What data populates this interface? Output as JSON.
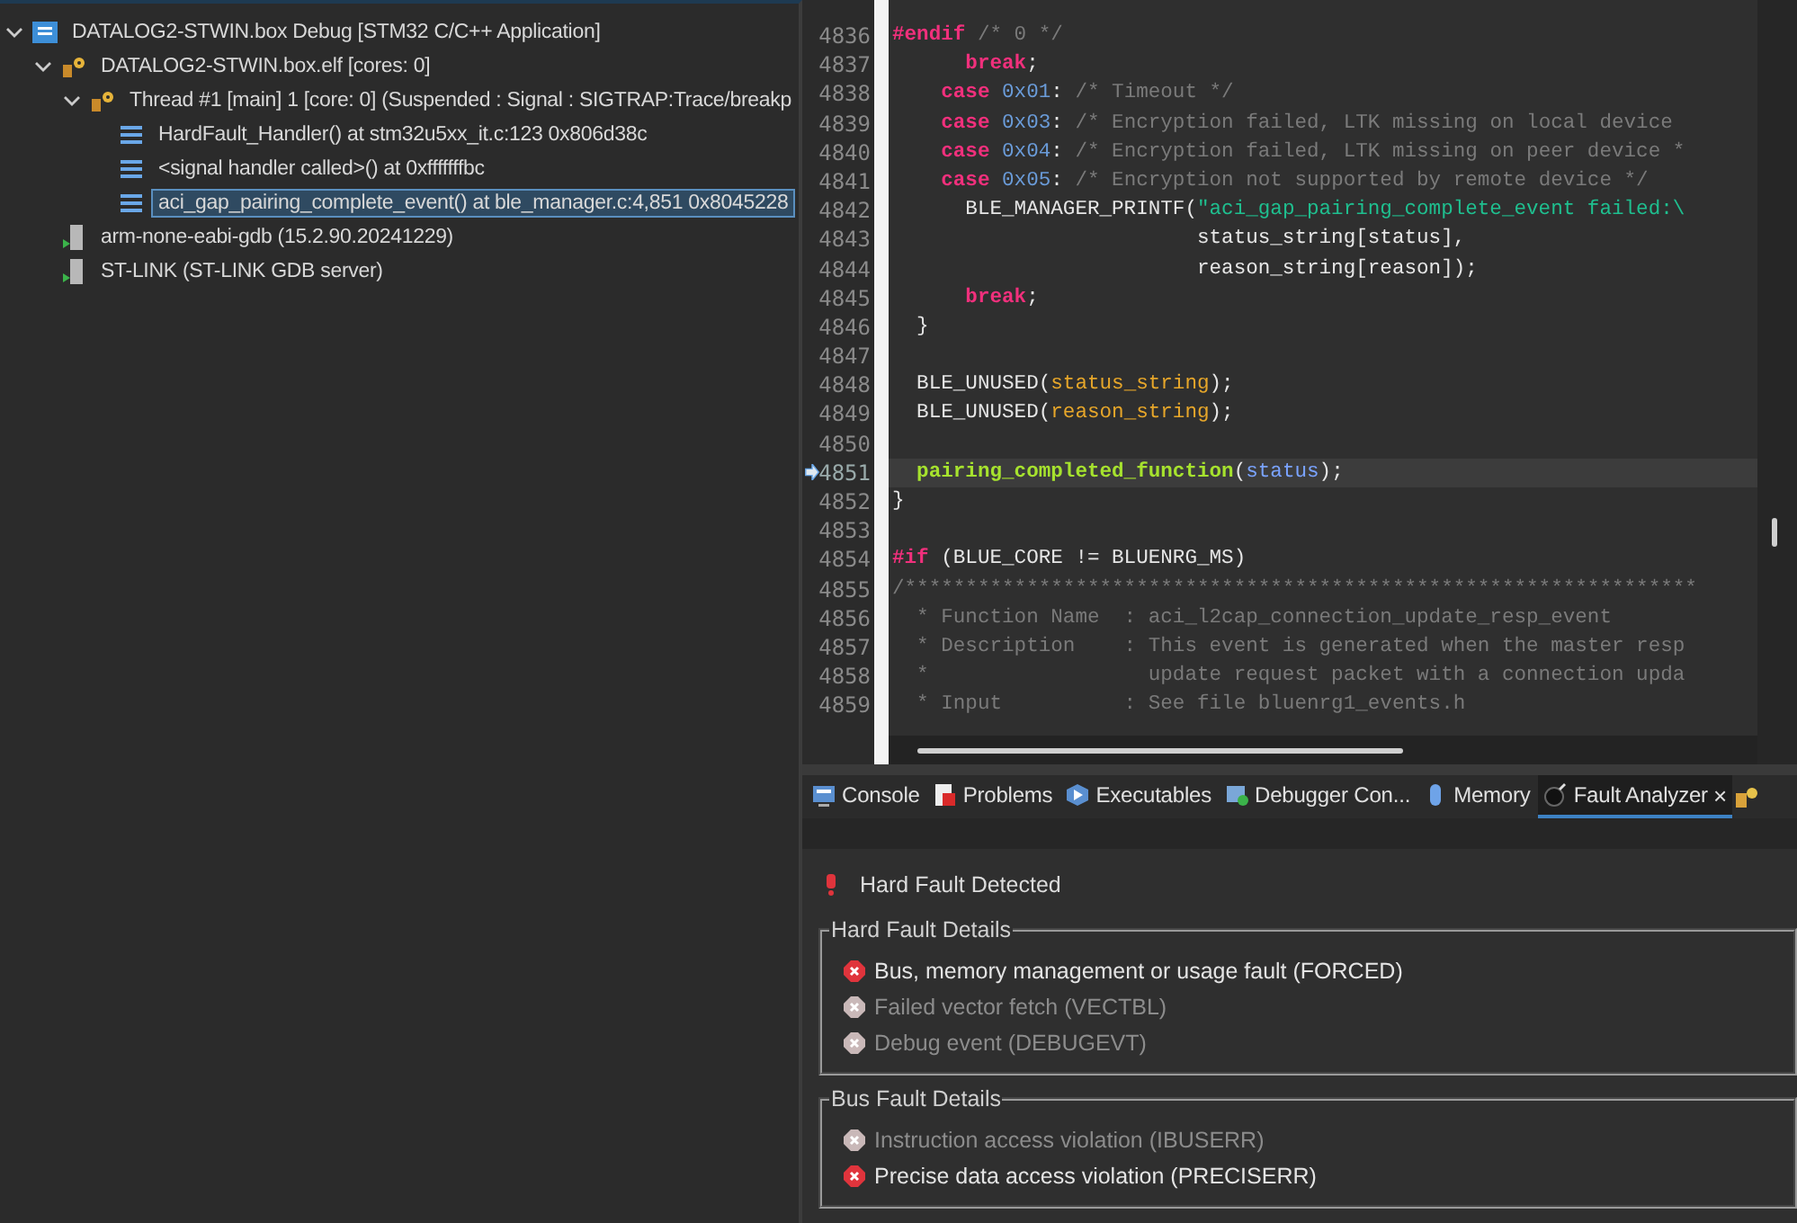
{
  "debug_tree": [
    {
      "label": "DATALOG2-STWIN.box Debug [STM32 C/C++ Application]",
      "kind": "launch",
      "expanded": true,
      "selected": false,
      "children": [
        {
          "label": "DATALOG2-STWIN.box.elf [cores: 0]",
          "kind": "process",
          "expanded": true,
          "selected": false,
          "children": [
            {
              "label": "Thread #1 [main] 1 [core: 0] (Suspended : Signal : SIGTRAP:Trace/breakp",
              "kind": "thread",
              "expanded": true,
              "selected": false,
              "children": [
                {
                  "label": "HardFault_Handler() at stm32u5xx_it.c:123 0x806d38c",
                  "kind": "frame",
                  "selected": false
                },
                {
                  "label": "<signal handler called>() at 0xfffffffbc",
                  "kind": "frame",
                  "selected": false
                },
                {
                  "label": "aci_gap_pairing_complete_event() at ble_manager.c:4,851 0x8045228",
                  "kind": "frame",
                  "selected": true
                }
              ]
            }
          ]
        },
        {
          "label": "arm-none-eabi-gdb (15.2.90.20241229)",
          "kind": "server",
          "selected": false
        },
        {
          "label": "ST-LINK (ST-LINK GDB server)",
          "kind": "server",
          "selected": false
        }
      ]
    }
  ],
  "editor": {
    "lines": [
      {
        "number": "4836",
        "current": false,
        "tokens": [
          {
            "kind": "keyword",
            "text": "#endif"
          },
          {
            "kind": "comment",
            "text": " /* 0 */"
          }
        ]
      },
      {
        "number": "4837",
        "current": false,
        "tokens": [
          {
            "kind": "keyword",
            "text": "      break"
          },
          {
            "kind": "plain",
            "text": ";"
          }
        ]
      },
      {
        "number": "4838",
        "current": false,
        "tokens": [
          {
            "kind": "keyword",
            "text": "    case"
          },
          {
            "kind": "number",
            "text": " 0x01"
          },
          {
            "kind": "plain",
            "text": ": "
          },
          {
            "kind": "comment",
            "text": "/* Timeout */"
          }
        ]
      },
      {
        "number": "4839",
        "current": false,
        "tokens": [
          {
            "kind": "keyword",
            "text": "    case"
          },
          {
            "kind": "number",
            "text": " 0x03"
          },
          {
            "kind": "plain",
            "text": ": "
          },
          {
            "kind": "comment",
            "text": "/* Encryption failed, LTK missing on local device"
          }
        ]
      },
      {
        "number": "4840",
        "current": false,
        "tokens": [
          {
            "kind": "keyword",
            "text": "    case"
          },
          {
            "kind": "number",
            "text": " 0x04"
          },
          {
            "kind": "plain",
            "text": ": "
          },
          {
            "kind": "comment",
            "text": "/* Encryption failed, LTK missing on peer device *"
          }
        ]
      },
      {
        "number": "4841",
        "current": false,
        "tokens": [
          {
            "kind": "keyword",
            "text": "    case"
          },
          {
            "kind": "number",
            "text": " 0x05"
          },
          {
            "kind": "plain",
            "text": ": "
          },
          {
            "kind": "comment",
            "text": "/* Encryption not supported by remote device */"
          }
        ]
      },
      {
        "number": "4842",
        "current": false,
        "tokens": [
          {
            "kind": "plain",
            "text": "      BLE_MANAGER_PRINTF("
          },
          {
            "kind": "string",
            "text": "\"aci_gap_pairing_complete_event failed:\\"
          }
        ]
      },
      {
        "number": "4843",
        "current": false,
        "tokens": [
          {
            "kind": "plain",
            "text": "                         status_string[status],"
          }
        ]
      },
      {
        "number": "4844",
        "current": false,
        "tokens": [
          {
            "kind": "plain",
            "text": "                         reason_string[reason]);"
          }
        ]
      },
      {
        "number": "4845",
        "current": false,
        "tokens": [
          {
            "kind": "keyword",
            "text": "      break"
          },
          {
            "kind": "plain",
            "text": ";"
          }
        ]
      },
      {
        "number": "4846",
        "current": false,
        "tokens": [
          {
            "kind": "plain",
            "text": "  }"
          }
        ]
      },
      {
        "number": "4847",
        "current": false
      },
      {
        "number": "4848",
        "current": false,
        "tokens": [
          {
            "kind": "plain",
            "text": "  BLE_UNUSED("
          },
          {
            "kind": "param",
            "text": "status_string"
          },
          {
            "kind": "plain",
            "text": ");"
          }
        ]
      },
      {
        "number": "4849",
        "current": false,
        "tokens": [
          {
            "kind": "plain",
            "text": "  BLE_UNUSED("
          },
          {
            "kind": "param",
            "text": "reason_string"
          },
          {
            "kind": "plain",
            "text": ");"
          }
        ]
      },
      {
        "number": "4850",
        "current": false
      },
      {
        "number": "4851",
        "current": true,
        "tokens": [
          {
            "kind": "function",
            "text": "  pairing_completed_function"
          },
          {
            "kind": "plain",
            "text": "("
          },
          {
            "kind": "variable",
            "text": "status"
          },
          {
            "kind": "plain",
            "text": ");"
          }
        ]
      },
      {
        "number": "4852",
        "current": false,
        "tokens": [
          {
            "kind": "plain",
            "text": "}"
          }
        ]
      },
      {
        "number": "4853",
        "current": false
      },
      {
        "number": "4854",
        "current": false,
        "tokens": [
          {
            "kind": "keyword",
            "text": "#if"
          },
          {
            "kind": "plain",
            "text": " (BLUE_CORE != BLUENRG_MS)"
          }
        ]
      },
      {
        "number": "4855",
        "current": false,
        "tokens": [
          {
            "kind": "comment",
            "text": "/*****************************************************************"
          }
        ]
      },
      {
        "number": "4856",
        "current": false,
        "tokens": [
          {
            "kind": "comment",
            "text": "  * Function Name  : aci_l2cap_connection_update_resp_event"
          }
        ]
      },
      {
        "number": "4857",
        "current": false,
        "tokens": [
          {
            "kind": "comment",
            "text": "  * Description    : This event is generated when the master resp"
          }
        ]
      },
      {
        "number": "4858",
        "current": false,
        "tokens": [
          {
            "kind": "comment",
            "text": "  *                  update request packet with a connection upda"
          }
        ]
      },
      {
        "number": "4859",
        "current": false,
        "tokens": [
          {
            "kind": "comment",
            "text": "  * Input          : See file bluenrg1_events.h"
          }
        ]
      }
    ]
  },
  "bottom_panel": {
    "tabs": [
      {
        "label": "Console",
        "kind": "console",
        "selected": false
      },
      {
        "label": "Problems",
        "kind": "problems",
        "selected": false
      },
      {
        "label": "Executables",
        "kind": "executables",
        "selected": false
      },
      {
        "label": "Debugger Con...",
        "kind": "debugger",
        "selected": false
      },
      {
        "label": "Memory",
        "kind": "memory",
        "selected": false
      },
      {
        "label": "Fault Analyzer",
        "kind": "fault",
        "selected": true,
        "close": "×"
      }
    ],
    "status": "Hard Fault Detected",
    "groups": [
      {
        "title": "Hard Fault Details",
        "items": [
          {
            "label": "Bus, memory management or usage fault (FORCED)",
            "active": true
          },
          {
            "label": "Failed vector fetch (VECTBL)",
            "active": false
          },
          {
            "label": "Debug event (DEBUGEVT)",
            "active": false
          }
        ]
      },
      {
        "title": "Bus Fault Details",
        "items": [
          {
            "label": "Instruction access violation (IBUSERR)",
            "active": false
          },
          {
            "label": "Precise data access violation (PRECISERR)",
            "active": true
          }
        ]
      }
    ]
  }
}
